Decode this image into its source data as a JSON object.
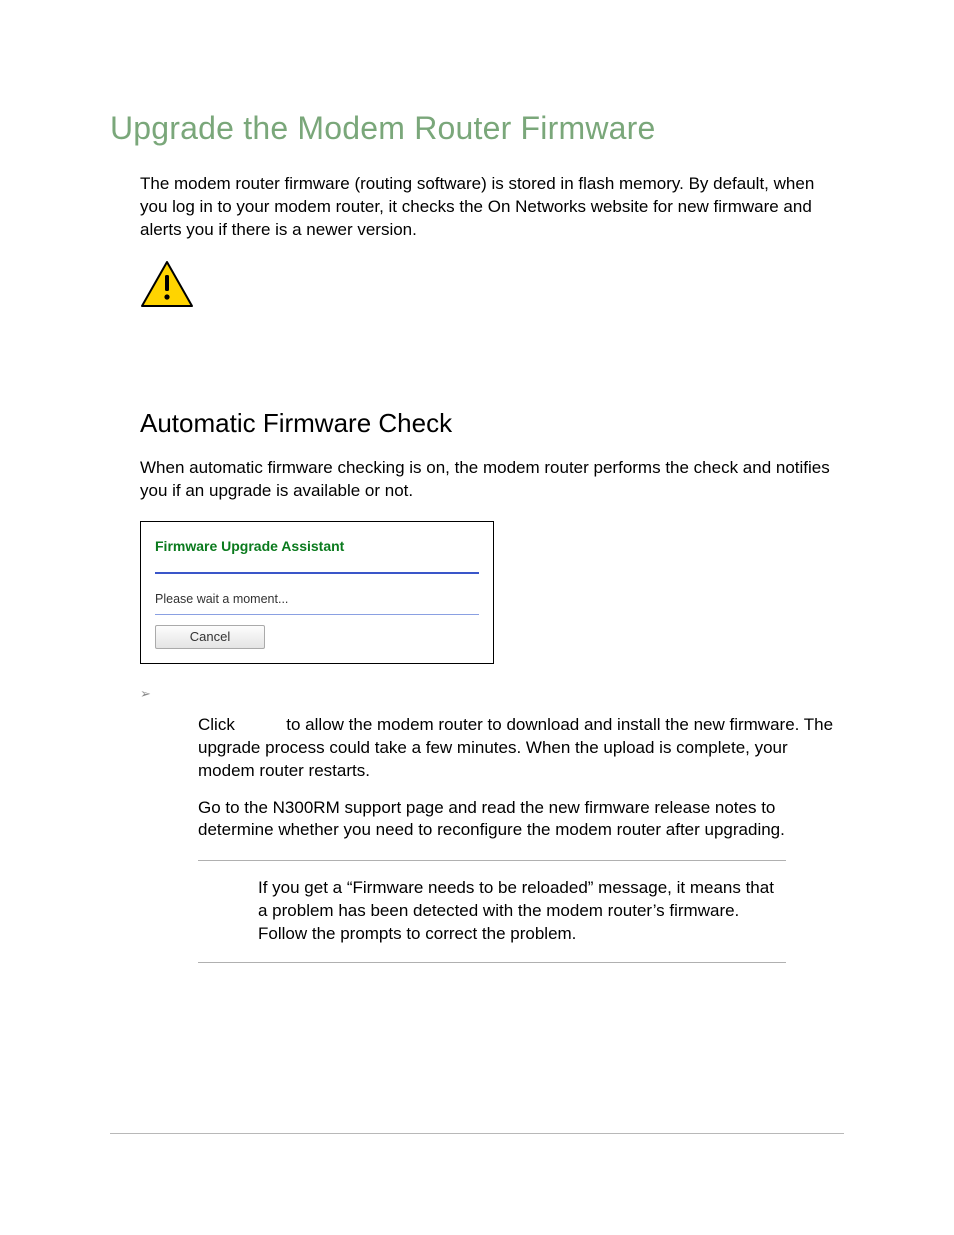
{
  "h1": "Upgrade the Modem Router Firmware",
  "intro": "The modem router firmware (routing software) is stored in flash memory. By default, when you log in to your modem router, it checks the On Networks website for new firmware and alerts you if there is a newer version.",
  "h2": "Automatic Firmware Check",
  "para2": "When automatic firmware checking is on, the modem router performs the check and notifies you if an upgrade is available or not.",
  "panel": {
    "title": "Firmware Upgrade Assistant",
    "status": "Please wait a moment...",
    "cancel": "Cancel"
  },
  "bullet_glyph": "➢",
  "step1_prefix": "Click ",
  "step1_rest": " to allow the modem router to download and install the new firmware. The upgrade process could take a few minutes. When the upload is complete, your modem router restarts.",
  "step2": "Go to the N300RM support page and read the new firmware release notes to determine whether you need to reconfigure the modem router after upgrading.",
  "note": "If you get a “Firmware needs to be reloaded” message, it means that a problem has been detected with the modem router’s firmware. Follow the prompts to correct the problem."
}
